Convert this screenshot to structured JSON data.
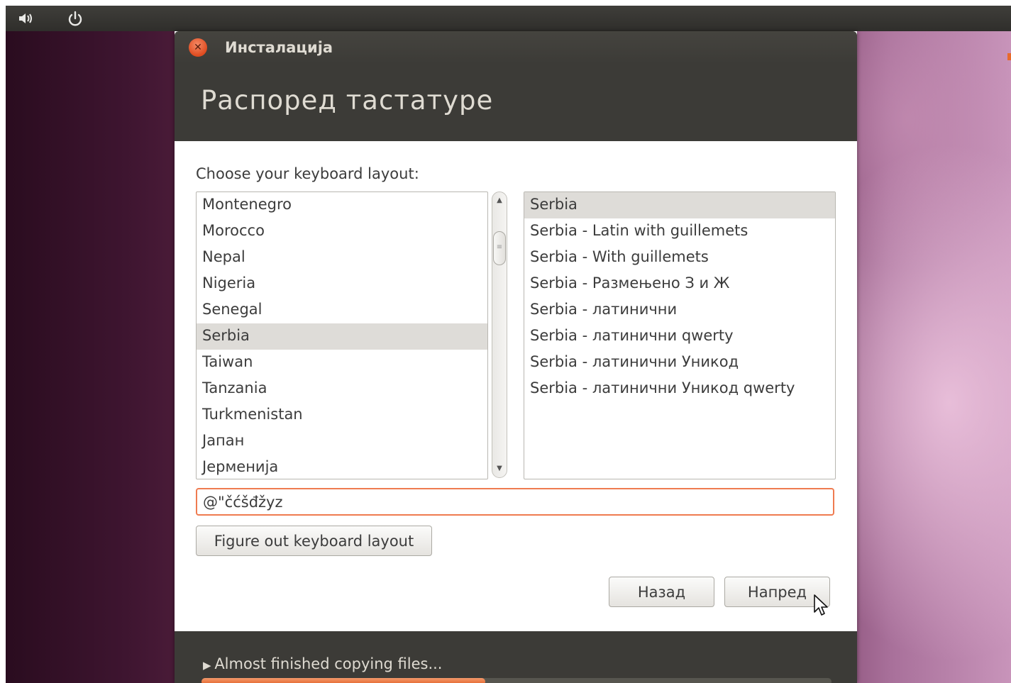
{
  "window": {
    "title": "Инсталација",
    "page_title": "Распоред тастатуре"
  },
  "prompt": "Choose your keyboard layout:",
  "layouts": [
    "Montenegro",
    "Morocco",
    "Nepal",
    "Nigeria",
    "Senegal",
    "Serbia",
    "Taiwan",
    "Tanzania",
    "Turkmenistan",
    "Јапан",
    "Јерменија"
  ],
  "selected_layout": "Serbia",
  "variants": [
    "Serbia",
    "Serbia - Latin with guillemets",
    "Serbia - With guillemets",
    "Serbia - Размењено З и Ж",
    "Serbia - латинични",
    "Serbia - латинични qwerty",
    "Serbia - латинични Уникод",
    "Serbia - латинични Уникод qwerty"
  ],
  "selected_variant": "Serbia",
  "test_input": {
    "value": "@\"čćšđžyz"
  },
  "buttons": {
    "figure_out": "Figure out keyboard layout",
    "back": "Назад",
    "next": "Напред"
  },
  "progress": {
    "label": "Almost finished copying files...",
    "fraction": 0.45
  },
  "colors": {
    "accent": "#e35f25",
    "chrome": "#3c3b37",
    "selection": "#dedcd8"
  },
  "icons": {
    "volume": "volume-icon",
    "power": "power-icon",
    "close": "close-icon",
    "expander": "expander-triangle-icon"
  }
}
